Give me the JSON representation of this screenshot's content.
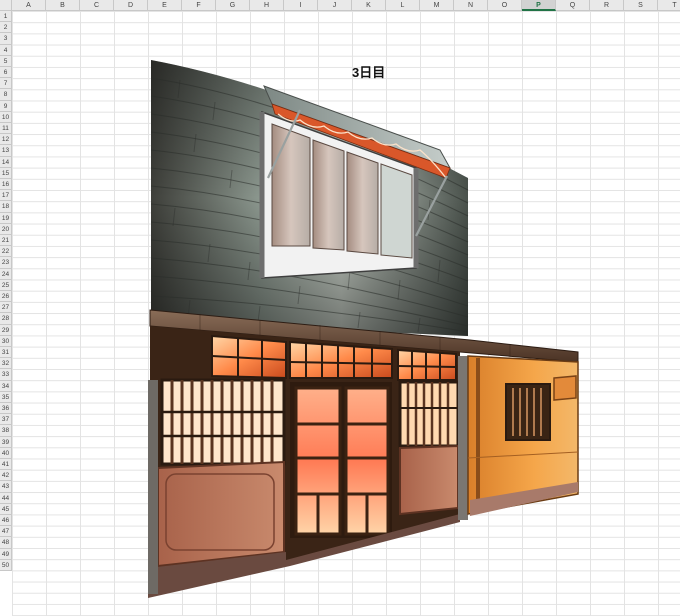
{
  "spreadsheet": {
    "columns": [
      "A",
      "B",
      "C",
      "D",
      "E",
      "F",
      "G",
      "H",
      "I",
      "J",
      "K",
      "L",
      "M",
      "N",
      "O",
      "P",
      "Q",
      "R",
      "S",
      "T"
    ],
    "selected_column": "P",
    "rows": [
      "1",
      "2",
      "3",
      "4",
      "5",
      "6",
      "7",
      "8",
      "9",
      "10",
      "11",
      "12",
      "13",
      "14",
      "15",
      "16",
      "17",
      "18",
      "19",
      "20",
      "21",
      "22",
      "23",
      "24",
      "25",
      "26",
      "27",
      "28",
      "29",
      "30",
      "31",
      "32",
      "33",
      "34",
      "35",
      "36",
      "37",
      "38",
      "39",
      "40",
      "41",
      "42",
      "43",
      "44",
      "45",
      "46",
      "47",
      "48",
      "49",
      "50"
    ],
    "cell_text": "3日目"
  },
  "artwork": {
    "subject": "storefront-illustration"
  }
}
